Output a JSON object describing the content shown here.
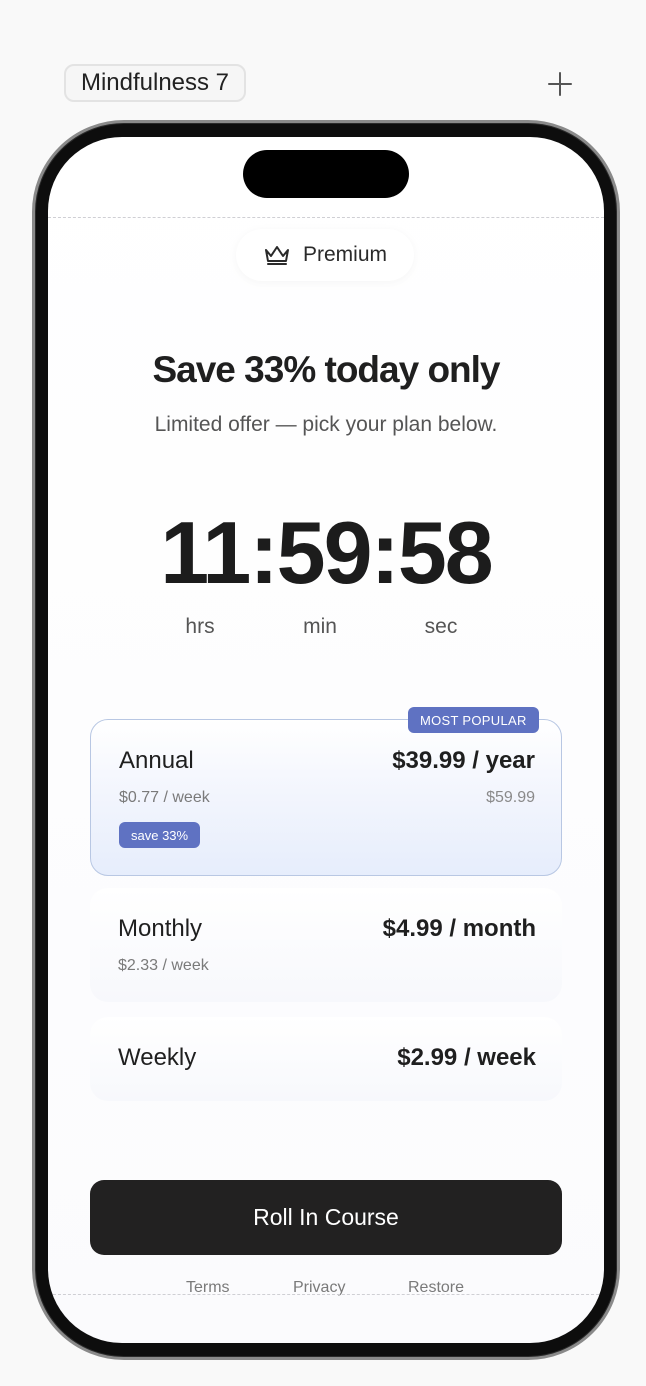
{
  "tab": {
    "title": "Mindfulness 7"
  },
  "badge": {
    "label": "Premium",
    "icon": "crown-icon"
  },
  "headline": "Save 33% today only",
  "subheadline": "Limited offer — pick your plan below.",
  "countdown": {
    "display": "11:59:58",
    "hours_label": "hrs",
    "minutes_label": "min",
    "seconds_label": "sec"
  },
  "plans": [
    {
      "name": "Annual",
      "price": "$39.99 / year",
      "per_week": "$0.77 / week",
      "original_price": "$59.99",
      "discount_tag": "save 33%",
      "badge": "MOST POPULAR",
      "selected": true
    },
    {
      "name": "Monthly",
      "price": "$4.99 / month",
      "per_week": "$2.33 / week"
    },
    {
      "name": "Weekly",
      "price": "$2.99 / week"
    }
  ],
  "cta": {
    "label": "Roll In Course"
  },
  "footer": {
    "terms": "Terms",
    "privacy": "Privacy",
    "restore": "Restore"
  },
  "colors": {
    "accent": "#5f72c2",
    "button": "#222121",
    "text": "#1f1f1f"
  }
}
